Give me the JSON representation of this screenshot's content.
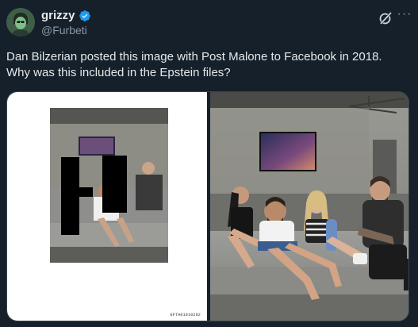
{
  "author": {
    "display_name": "grizzy",
    "handle": "@Furbeti",
    "verified": true,
    "avatar_icon": "avatar-icon"
  },
  "header_actions": {
    "grok_icon": "grok-icon",
    "more_label": "···"
  },
  "tweet": {
    "text": "Dan Bilzerian posted this image with Post Malone to Facebook in 2018. Why was this included in the Epstein files?"
  },
  "media": {
    "left_document_id": "EFTA01910292",
    "accent_colors": {
      "verified": "#1d9bf0",
      "background": "#15202b",
      "secondary_text": "#8b98a5"
    }
  }
}
